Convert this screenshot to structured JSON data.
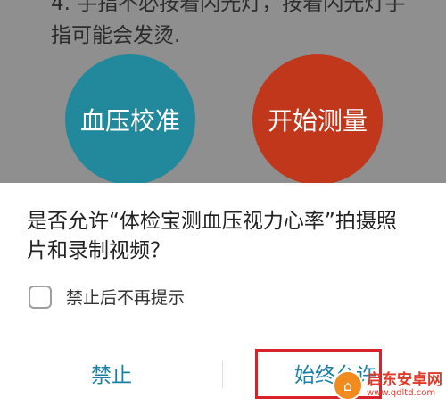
{
  "background": {
    "instruction_lines": [
      "4. 手指不必按着闪光灯，按着闪光灯手",
      "指可能会发烫."
    ],
    "calibrate_label": "血压校准",
    "measure_label": "开始测量",
    "colors": {
      "calibrate": "#22889c",
      "measure": "#c1371b"
    }
  },
  "dialog": {
    "message_lines": [
      "是否允许“体检宝测血压视力心率”拍摄照",
      "片和录制视频？"
    ],
    "checkbox_label": "禁止后不再提示",
    "deny_label": "禁止",
    "allow_label": "始终允许",
    "accent_color": "#1a7fa4"
  },
  "watermark": {
    "title": "启东安卓网",
    "url": "www.qdltd.com",
    "icon": "watermark-logo-icon"
  }
}
